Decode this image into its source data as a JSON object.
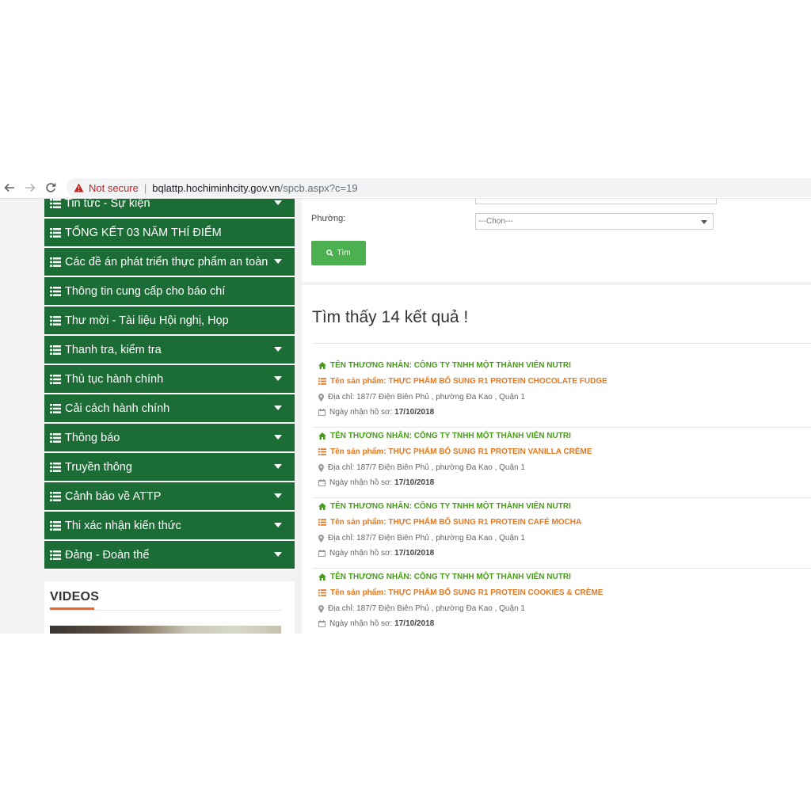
{
  "browser": {
    "security_text": "Not secure",
    "url_host": "bqlattp.hochiminhcity.gov.vn",
    "url_path": "/spcb.aspx?c=19"
  },
  "menu": {
    "items": [
      {
        "label": "Tin tức - Sự kiện",
        "has_caret": true
      },
      {
        "label": "TỔNG KẾT 03 NĂM THÍ ĐIỂM",
        "has_caret": false
      },
      {
        "label": "Các đề án phát triển thực phẩm an toàn",
        "has_caret": true
      },
      {
        "label": "Thông tin cung cấp cho báo chí",
        "has_caret": false
      },
      {
        "label": "Thư mời - Tài liệu Hội nghị, Họp",
        "has_caret": false
      },
      {
        "label": "Thanh tra, kiểm tra",
        "has_caret": true
      },
      {
        "label": "Thủ tục hành chính",
        "has_caret": true
      },
      {
        "label": "Cải cách hành chính",
        "has_caret": true
      },
      {
        "label": "Thông báo",
        "has_caret": true
      },
      {
        "label": "Truyền thông",
        "has_caret": true
      },
      {
        "label": "Cảnh báo về ATTP",
        "has_caret": true
      },
      {
        "label": "Thi xác nhận kiến thức",
        "has_caret": true
      },
      {
        "label": "Đảng - Đoàn thể",
        "has_caret": true
      }
    ]
  },
  "videos": {
    "title": "VIDEOS"
  },
  "form": {
    "ward_label": "Phường:",
    "ward_value": "---Chọn---",
    "search_label": "Tìm"
  },
  "results": {
    "title": "Tìm thấy 14 kết quả !",
    "items": [
      {
        "merchant": "TÊN THƯƠNG NHÂN: CÔNG TY TNHH MỘT THÀNH VIÊN NUTRI",
        "product_prefix": "Tên sản phẩm:",
        "product": "THỰC PHẨM BỔ SUNG R1 PROTEIN CHOCOLATE FUDGE",
        "address": "Địa chỉ: 187/7 Điện Biên Phủ , phường Đa Kao , Quận 1",
        "date_prefix": "Ngày nhận hồ sơ:",
        "date": "17/10/2018"
      },
      {
        "merchant": "TÊN THƯƠNG NHÂN: CÔNG TY TNHH MỘT THÀNH VIÊN NUTRI",
        "product_prefix": "Tên sản phẩm:",
        "product": "THỰC PHẨM BỔ SUNG R1 PROTEIN VANILLA CRÈME",
        "address": "Địa chỉ: 187/7 Điện Biên Phủ , phường Đa Kao , Quận 1",
        "date_prefix": "Ngày nhận hồ sơ:",
        "date": "17/10/2018"
      },
      {
        "merchant": "TÊN THƯƠNG NHÂN: CÔNG TY TNHH MỘT THÀNH VIÊN NUTRI",
        "product_prefix": "Tên sản phẩm:",
        "product": "THỰC PHẨM BỔ SUNG R1 PROTEIN CAFÉ MOCHA",
        "address": "Địa chỉ: 187/7 Điện Biên Phủ , phường Đa Kao , Quận 1",
        "date_prefix": "Ngày nhận hồ sơ:",
        "date": "17/10/2018"
      },
      {
        "merchant": "TÊN THƯƠNG NHÂN: CÔNG TY TNHH MỘT THÀNH VIÊN NUTRI",
        "product_prefix": "Tên sản phẩm:",
        "product": "THỰC PHẨM BỔ SUNG R1 PROTEIN COOKIES & CRÈME",
        "address": "Địa chỉ: 187/7 Điện Biên Phủ , phường Đa Kao , Quận 1",
        "date_prefix": "Ngày nhận hồ sơ:",
        "date": "17/10/2018"
      }
    ]
  },
  "colors": {
    "menu_bg": "#1b6d35",
    "merchant_green": "#4a9a1e",
    "product_orange": "#e8771f",
    "button_green": "#4caf50",
    "accent_orange": "#f26522"
  },
  "icons": {
    "menu": "list-icon",
    "merchant": "home-icon",
    "product": "list-icon",
    "address": "map-marker-icon",
    "date": "calendar-icon",
    "search": "search-icon"
  }
}
